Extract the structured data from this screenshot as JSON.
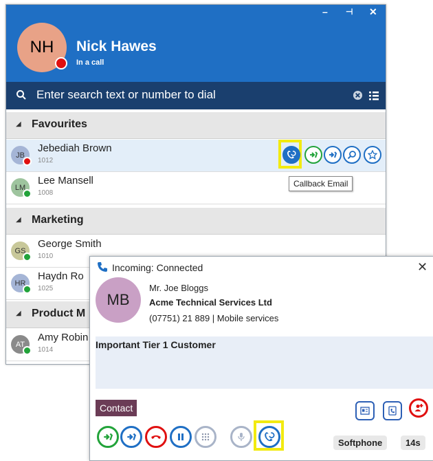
{
  "window_controls": {
    "minimize": "–",
    "pin": "⊣",
    "close": "✕"
  },
  "user": {
    "initials": "NH",
    "name": "Nick Hawes",
    "status": "In a call"
  },
  "search": {
    "placeholder": "Enter search text or number to dial"
  },
  "groups": [
    {
      "label": "Favourites"
    },
    {
      "label": "Marketing"
    },
    {
      "label": "Product M"
    }
  ],
  "contacts": [
    {
      "initials": "JB",
      "name": "Jebediah Brown",
      "ext": "1012",
      "status": "busy"
    },
    {
      "initials": "LM",
      "name": "Lee Mansell",
      "ext": "1008",
      "status": "available"
    },
    {
      "initials": "GS",
      "name": "George Smith",
      "ext": "1010",
      "status": "available"
    },
    {
      "initials": "HR",
      "name": "Haydn Ro",
      "ext": "1025",
      "status": "available"
    },
    {
      "initials": "AT",
      "name": "Amy Robin",
      "ext": "1014",
      "status": "available"
    }
  ],
  "tooltip": "Callback Email",
  "popup": {
    "title": "Incoming: Connected",
    "caller_initials": "MB",
    "caller_name": "Mr. Joe Bloggs",
    "company": "Acme Technical Services Ltd",
    "phone": "(07751) 21 889 | Mobile services",
    "notes": "Important Tier 1 Customer",
    "contact_tab": "Contact",
    "device": "Softphone",
    "duration": "14s"
  },
  "colors": {
    "header": "#1f6fc4",
    "search_bar": "#1a3f6e",
    "available": "#22a33a",
    "busy": "#e01010",
    "highlight": "#f2ea10"
  }
}
